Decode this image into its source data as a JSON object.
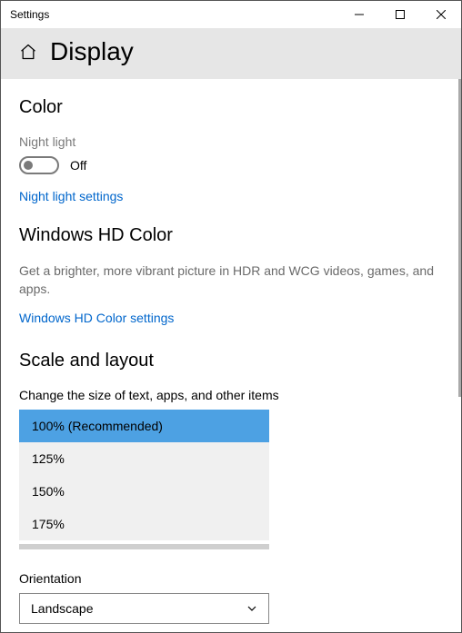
{
  "window": {
    "title": "Settings"
  },
  "header": {
    "title": "Display"
  },
  "color": {
    "section": "Color",
    "night_light_label": "Night light",
    "night_light_state": "Off",
    "night_light_link": "Night light settings"
  },
  "hd": {
    "section": "Windows HD Color",
    "desc": "Get a brighter, more vibrant picture in HDR and WCG videos, games, and apps.",
    "link": "Windows HD Color settings"
  },
  "scale": {
    "section": "Scale and layout",
    "size_label": "Change the size of text, apps, and other items",
    "options": {
      "o0": "100% (Recommended)",
      "o1": "125%",
      "o2": "150%",
      "o3": "175%"
    },
    "orientation_label": "Orientation",
    "orientation_value": "Landscape"
  }
}
